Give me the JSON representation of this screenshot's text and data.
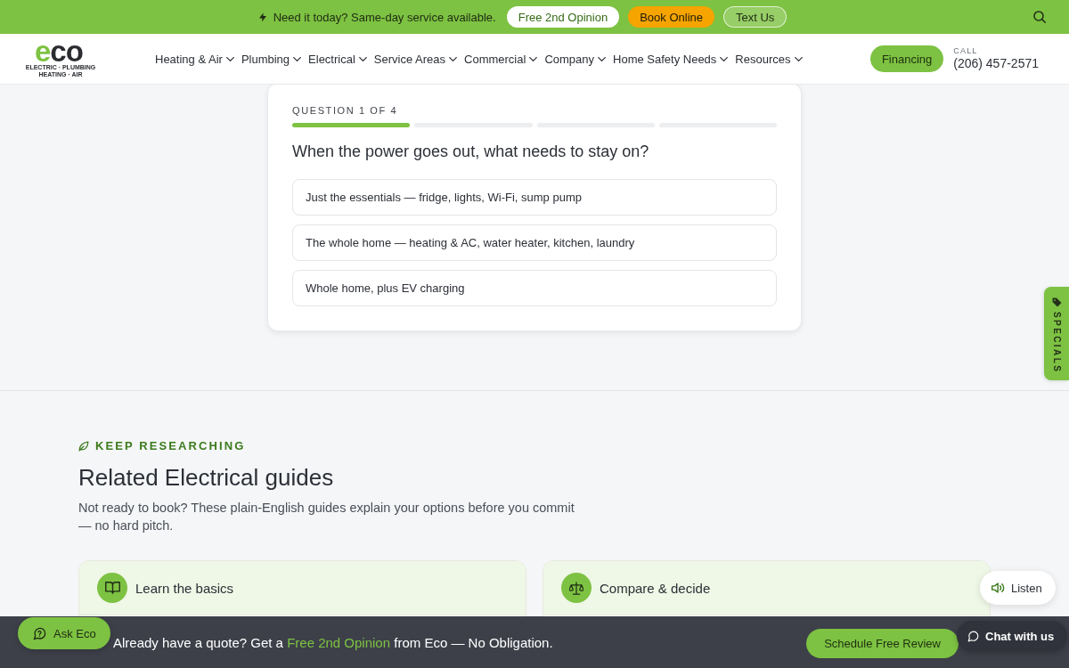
{
  "top_bar": {
    "message": "Need it today? Same-day service available.",
    "buttons": [
      {
        "label": "Free 2nd Opinion",
        "kind": "light"
      },
      {
        "label": "Book Online",
        "kind": "accent"
      },
      {
        "label": "Text Us",
        "kind": "outline"
      }
    ]
  },
  "header": {
    "logo": {
      "wordmark": "eco",
      "taglines": [
        "ELECTRIC · PLUMBING",
        "HEATING · AIR"
      ]
    },
    "nav": [
      {
        "label": "Heating & Air"
      },
      {
        "label": "Plumbing"
      },
      {
        "label": "Electrical"
      },
      {
        "label": "Service Areas"
      },
      {
        "label": "Commercial"
      },
      {
        "label": "Company"
      },
      {
        "label": "Home Safety Needs"
      },
      {
        "label": "Resources"
      }
    ],
    "financing_button": "Financing",
    "call_label": "CALL",
    "phone": "(206) 457-2571"
  },
  "quiz": {
    "progress_label": "QUESTION 1 OF 4",
    "steps": [
      {
        "complete": true
      },
      {
        "complete": false
      },
      {
        "complete": false
      },
      {
        "complete": false
      }
    ],
    "question": "When the power goes out, what needs to stay on?",
    "options": [
      {
        "label": "Just the essentials — fridge, lights, Wi-Fi, sump pump",
        "selected": false
      },
      {
        "label": "The whole home — heating & AC, water heater, kitchen, laundry",
        "selected": false
      },
      {
        "label": "Whole home, plus EV charging",
        "selected": false
      }
    ]
  },
  "related": {
    "eyebrow": "KEEP RESEARCHING",
    "title": "Related Electrical guides",
    "intro": "Not ready to book? These plain-English guides explain your options before you commit — no hard pitch.",
    "cards": [
      {
        "title": "Learn the basics",
        "kind": "book"
      },
      {
        "title": "Compare & decide",
        "kind": "scale"
      }
    ]
  },
  "specials_tab": {
    "label": "SPECIALS"
  },
  "listen_button": {
    "label": "Listen"
  },
  "bottom_bar": {
    "message_before": "Already have a quote? Get a",
    "link": "Free 2nd Opinion",
    "message_after": "from Eco — No Obligation.",
    "button": "Schedule Free Review"
  },
  "chat_button": {
    "label": "Chat with us"
  },
  "ask_button": {
    "label": "Ask Eco"
  }
}
